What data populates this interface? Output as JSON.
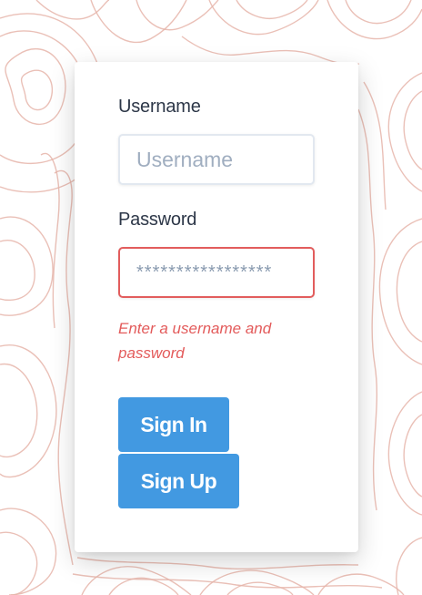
{
  "form": {
    "username_label": "Username",
    "username_placeholder": "Username",
    "username_value": "",
    "password_label": "Password",
    "password_value": "*****************",
    "error_text": "Enter a username and password",
    "signin_label": "Sign In",
    "signup_label": "Sign Up"
  },
  "colors": {
    "background": "#ffffff",
    "contour_lines": "#e6b5aa",
    "button_primary": "#4299e1",
    "error": "#e35b5b",
    "input_error_border": "#e25d5d"
  }
}
